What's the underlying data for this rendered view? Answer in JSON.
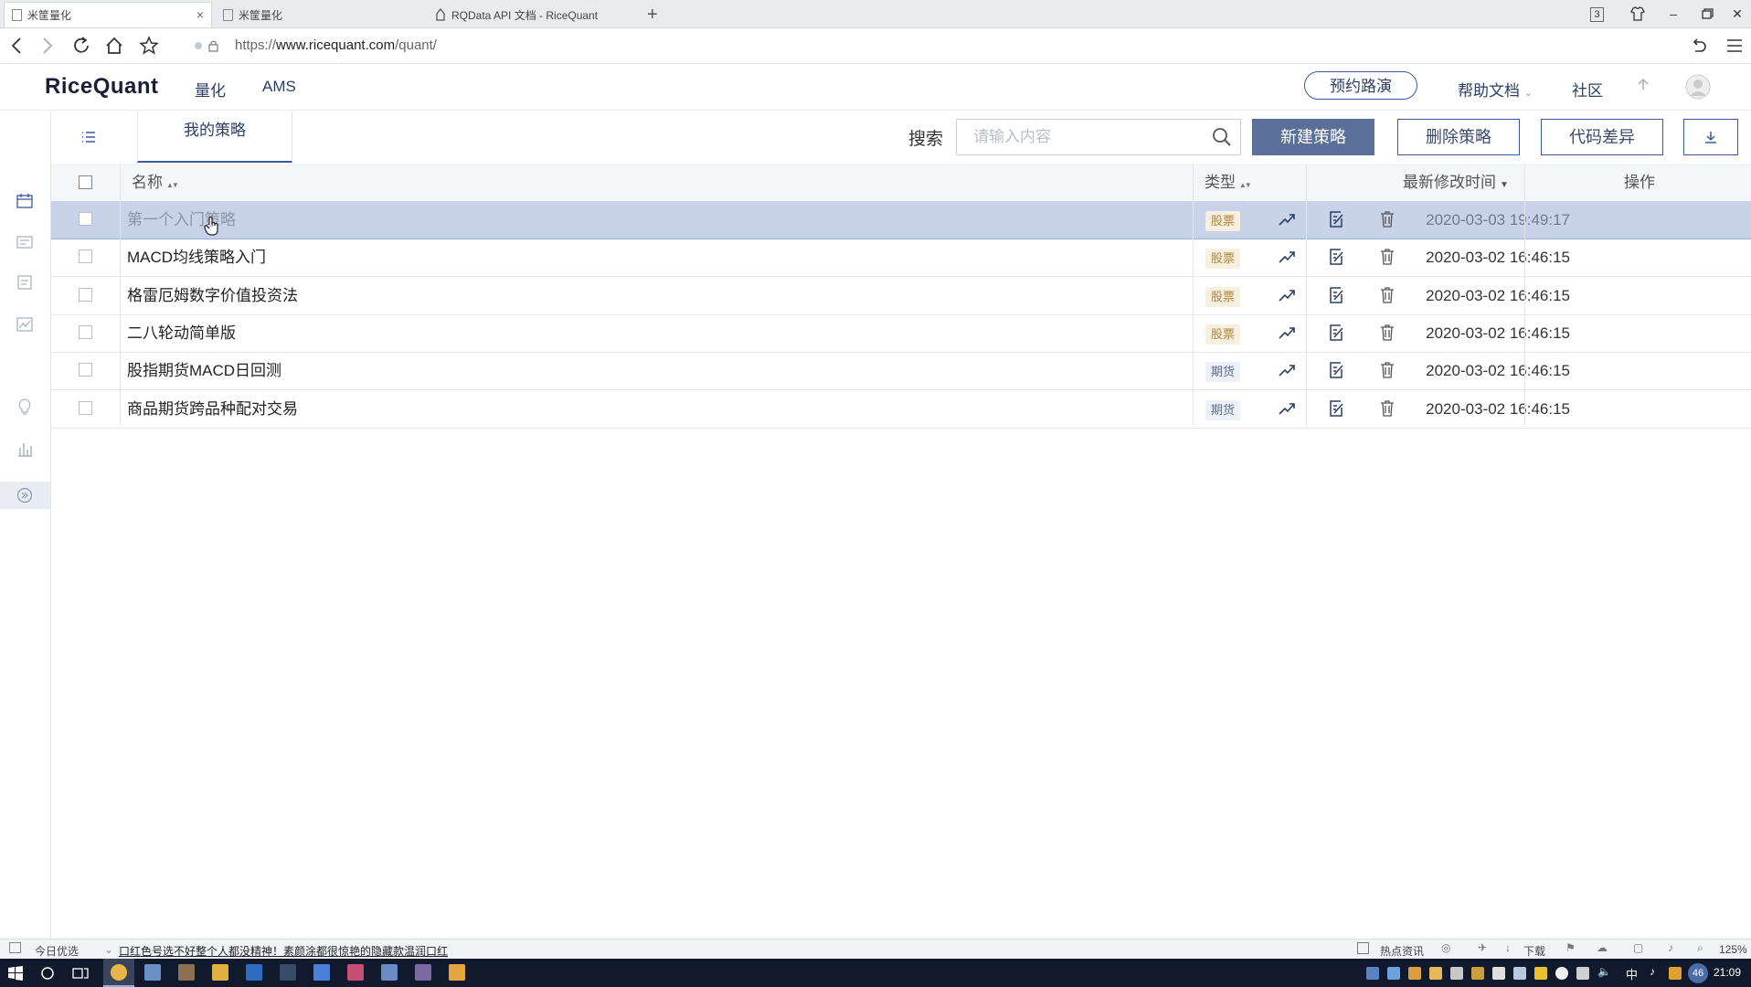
{
  "browser": {
    "tabs": [
      {
        "title": "米筐量化",
        "active": true
      },
      {
        "title": "米筐量化",
        "active": false
      },
      {
        "title": "RQData API 文档 - RiceQuant",
        "active": false
      }
    ],
    "new_tab": "+",
    "tab_count": "3",
    "url_prefix": "https://",
    "url_host": "www.ricequant.com",
    "url_path": "/quant/"
  },
  "site": {
    "logo": "RiceQuant",
    "nav": [
      "量化",
      "AMS"
    ],
    "demo_button": "预约路演",
    "help_docs": "帮助文档",
    "community": "社区"
  },
  "toolbar": {
    "tab": "我的策略",
    "search_label": "搜索",
    "search_placeholder": "请输入内容",
    "new_button": "新建策略",
    "delete_button": "删除策略",
    "diff_button": "代码差异"
  },
  "table": {
    "headers": {
      "name": "名称",
      "type": "类型",
      "modified": "最新修改时间",
      "actions": "操作"
    },
    "sort_both": "▲▼",
    "sort_down": "▼",
    "rows": [
      {
        "name": "第一个入门策略",
        "type": "股票",
        "time": "2020-03-03 19:49:17"
      },
      {
        "name": "MACD均线策略入门",
        "type": "股票",
        "time": "2020-03-02 16:46:15"
      },
      {
        "name": "格雷厄姆数字价值投资法",
        "type": "股票",
        "time": "2020-03-02 16:46:15"
      },
      {
        "name": "二八轮动简单版",
        "type": "股票",
        "time": "2020-03-02 16:46:15"
      },
      {
        "name": "股指期货MACD日回测",
        "type": "期货",
        "time": "2020-03-02 16:46:15"
      },
      {
        "name": "商品期货跨品种配对交易",
        "type": "期货",
        "time": "2020-03-02 16:46:15"
      }
    ]
  },
  "statusbar": {
    "left": "今日优选",
    "news": "口红色号选不好整个人都没精神！素颜涂都很惊艳的隐藏款温润口红",
    "hot": "热点资讯",
    "download": "下载",
    "zoom": "125%"
  },
  "taskbar": {
    "ime": "中",
    "tray_num": "46",
    "clock": "21:09"
  }
}
